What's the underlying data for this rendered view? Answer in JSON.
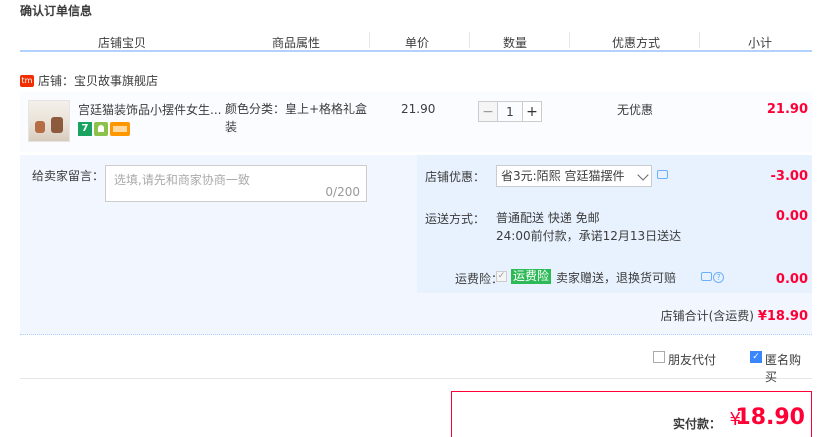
{
  "page": {
    "title": "确认订单信息"
  },
  "columns": [
    "店铺宝贝",
    "商品属性",
    "单价",
    "数量",
    "优惠方式",
    "小计"
  ],
  "shop": {
    "badge": "tm",
    "label": "店铺：宝贝故事旗舰店"
  },
  "item": {
    "name": "宫廷猫装饰品小摆件女生...",
    "attr": "颜色分类：皇上+格格礼盒装",
    "price": "21.90",
    "qty_minus": "−",
    "qty": "1",
    "qty_plus": "+",
    "discount": "无优惠",
    "subtotal": "21.90",
    "badge_7": "7"
  },
  "message": {
    "label": "给卖家留言：",
    "placeholder": "选填,请先和商家协商一致",
    "counter": "0/200"
  },
  "shop_discount": {
    "label": "店铺优惠：",
    "selected": "省3元:陌熙 宫廷猫摆件",
    "value": "-3.00"
  },
  "shipping": {
    "label": "运送方式：",
    "line1": "普通配送 快递 免邮",
    "line2": "24:00前付款，承诺12月13日送达",
    "value": "0.00"
  },
  "insurance": {
    "label": "运费险：",
    "tag": "运费险",
    "text": "卖家赠送，退换货可赔",
    "value": "0.00"
  },
  "shop_total": {
    "label": "店铺合计(含运费)",
    "value": "¥18.90"
  },
  "options": {
    "friend_pay": "朋友代付",
    "anonymous": "匿名购买"
  },
  "payment": {
    "label": "实付款：",
    "currency": "¥",
    "value": "18.90"
  },
  "colors": {
    "price_red": "#ff0036",
    "header_line": "#b2d1ff",
    "panel_bg": "#f2f7ff"
  }
}
